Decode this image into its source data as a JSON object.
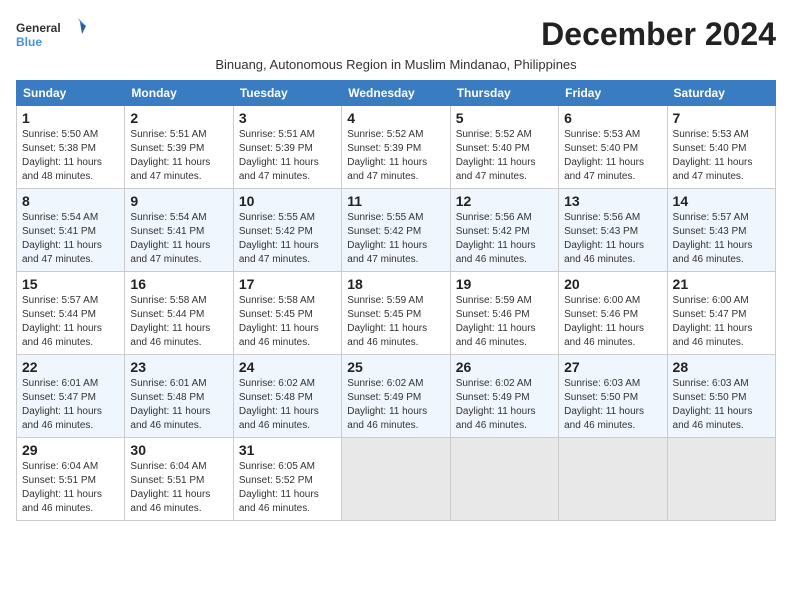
{
  "logo": {
    "line1": "General",
    "line2": "Blue"
  },
  "title": "December 2024",
  "subtitle": "Binuang, Autonomous Region in Muslim Mindanao, Philippines",
  "days_of_week": [
    "Sunday",
    "Monday",
    "Tuesday",
    "Wednesday",
    "Thursday",
    "Friday",
    "Saturday"
  ],
  "weeks": [
    [
      {
        "day": "1",
        "sunrise": "5:50 AM",
        "sunset": "5:38 PM",
        "daylight": "11 hours and 48 minutes."
      },
      {
        "day": "2",
        "sunrise": "5:51 AM",
        "sunset": "5:39 PM",
        "daylight": "11 hours and 47 minutes."
      },
      {
        "day": "3",
        "sunrise": "5:51 AM",
        "sunset": "5:39 PM",
        "daylight": "11 hours and 47 minutes."
      },
      {
        "day": "4",
        "sunrise": "5:52 AM",
        "sunset": "5:39 PM",
        "daylight": "11 hours and 47 minutes."
      },
      {
        "day": "5",
        "sunrise": "5:52 AM",
        "sunset": "5:40 PM",
        "daylight": "11 hours and 47 minutes."
      },
      {
        "day": "6",
        "sunrise": "5:53 AM",
        "sunset": "5:40 PM",
        "daylight": "11 hours and 47 minutes."
      },
      {
        "day": "7",
        "sunrise": "5:53 AM",
        "sunset": "5:40 PM",
        "daylight": "11 hours and 47 minutes."
      }
    ],
    [
      {
        "day": "8",
        "sunrise": "5:54 AM",
        "sunset": "5:41 PM",
        "daylight": "11 hours and 47 minutes."
      },
      {
        "day": "9",
        "sunrise": "5:54 AM",
        "sunset": "5:41 PM",
        "daylight": "11 hours and 47 minutes."
      },
      {
        "day": "10",
        "sunrise": "5:55 AM",
        "sunset": "5:42 PM",
        "daylight": "11 hours and 47 minutes."
      },
      {
        "day": "11",
        "sunrise": "5:55 AM",
        "sunset": "5:42 PM",
        "daylight": "11 hours and 47 minutes."
      },
      {
        "day": "12",
        "sunrise": "5:56 AM",
        "sunset": "5:42 PM",
        "daylight": "11 hours and 46 minutes."
      },
      {
        "day": "13",
        "sunrise": "5:56 AM",
        "sunset": "5:43 PM",
        "daylight": "11 hours and 46 minutes."
      },
      {
        "day": "14",
        "sunrise": "5:57 AM",
        "sunset": "5:43 PM",
        "daylight": "11 hours and 46 minutes."
      }
    ],
    [
      {
        "day": "15",
        "sunrise": "5:57 AM",
        "sunset": "5:44 PM",
        "daylight": "11 hours and 46 minutes."
      },
      {
        "day": "16",
        "sunrise": "5:58 AM",
        "sunset": "5:44 PM",
        "daylight": "11 hours and 46 minutes."
      },
      {
        "day": "17",
        "sunrise": "5:58 AM",
        "sunset": "5:45 PM",
        "daylight": "11 hours and 46 minutes."
      },
      {
        "day": "18",
        "sunrise": "5:59 AM",
        "sunset": "5:45 PM",
        "daylight": "11 hours and 46 minutes."
      },
      {
        "day": "19",
        "sunrise": "5:59 AM",
        "sunset": "5:46 PM",
        "daylight": "11 hours and 46 minutes."
      },
      {
        "day": "20",
        "sunrise": "6:00 AM",
        "sunset": "5:46 PM",
        "daylight": "11 hours and 46 minutes."
      },
      {
        "day": "21",
        "sunrise": "6:00 AM",
        "sunset": "5:47 PM",
        "daylight": "11 hours and 46 minutes."
      }
    ],
    [
      {
        "day": "22",
        "sunrise": "6:01 AM",
        "sunset": "5:47 PM",
        "daylight": "11 hours and 46 minutes."
      },
      {
        "day": "23",
        "sunrise": "6:01 AM",
        "sunset": "5:48 PM",
        "daylight": "11 hours and 46 minutes."
      },
      {
        "day": "24",
        "sunrise": "6:02 AM",
        "sunset": "5:48 PM",
        "daylight": "11 hours and 46 minutes."
      },
      {
        "day": "25",
        "sunrise": "6:02 AM",
        "sunset": "5:49 PM",
        "daylight": "11 hours and 46 minutes."
      },
      {
        "day": "26",
        "sunrise": "6:02 AM",
        "sunset": "5:49 PM",
        "daylight": "11 hours and 46 minutes."
      },
      {
        "day": "27",
        "sunrise": "6:03 AM",
        "sunset": "5:50 PM",
        "daylight": "11 hours and 46 minutes."
      },
      {
        "day": "28",
        "sunrise": "6:03 AM",
        "sunset": "5:50 PM",
        "daylight": "11 hours and 46 minutes."
      }
    ],
    [
      {
        "day": "29",
        "sunrise": "6:04 AM",
        "sunset": "5:51 PM",
        "daylight": "11 hours and 46 minutes."
      },
      {
        "day": "30",
        "sunrise": "6:04 AM",
        "sunset": "5:51 PM",
        "daylight": "11 hours and 46 minutes."
      },
      {
        "day": "31",
        "sunrise": "6:05 AM",
        "sunset": "5:52 PM",
        "daylight": "11 hours and 46 minutes."
      },
      null,
      null,
      null,
      null
    ]
  ],
  "labels": {
    "sunrise": "Sunrise: ",
    "sunset": "Sunset: ",
    "daylight": "Daylight: "
  }
}
